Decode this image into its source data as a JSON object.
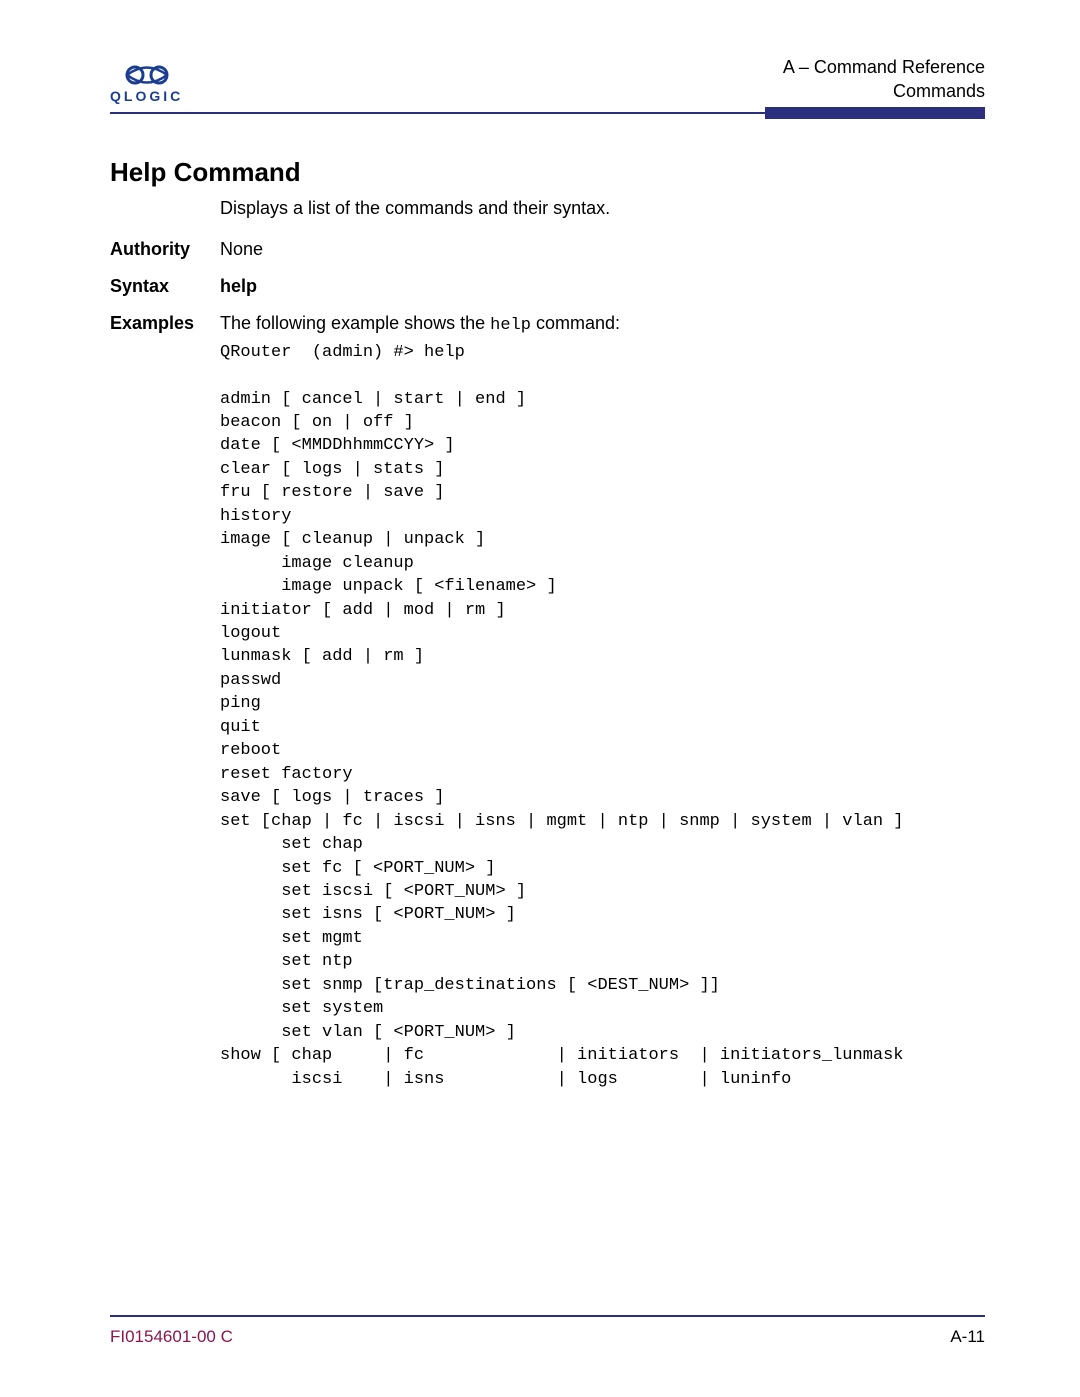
{
  "header": {
    "brand": "QLOGIC",
    "line1": "A – Command Reference",
    "line2": "Commands"
  },
  "title": "Help Command",
  "description": "Displays a list of the commands and their syntax.",
  "rows": {
    "authority_label": "Authority",
    "authority_value": "None",
    "syntax_label": "Syntax",
    "syntax_value": "help",
    "examples_label": "Examples",
    "examples_prefix": "The following example shows the ",
    "examples_code": "help",
    "examples_suffix": " command:"
  },
  "code": "QRouter  (admin) #> help\n\nadmin [ cancel | start | end ]\nbeacon [ on | off ]\ndate [ <MMDDhhmmCCYY> ]\nclear [ logs | stats ]\nfru [ restore | save ]\nhistory\nimage [ cleanup | unpack ]\n      image cleanup\n      image unpack [ <filename> ]\ninitiator [ add | mod | rm ]\nlogout\nlunmask [ add | rm ]\npasswd\nping\nquit\nreboot\nreset factory\nsave [ logs | traces ]\nset [chap | fc | iscsi | isns | mgmt | ntp | snmp | system | vlan ]\n      set chap\n      set fc [ <PORT_NUM> ]\n      set iscsi [ <PORT_NUM> ]\n      set isns [ <PORT_NUM> ]\n      set mgmt\n      set ntp\n      set snmp [trap_destinations [ <DEST_NUM> ]]\n      set system\n      set vlan [ <PORT_NUM> ]\nshow [ chap     | fc             | initiators  | initiators_lunmask\n       iscsi    | isns           | logs        | luninfo",
  "footer": {
    "docnum": "FI0154601-00  C",
    "pagenum": "A-11"
  }
}
